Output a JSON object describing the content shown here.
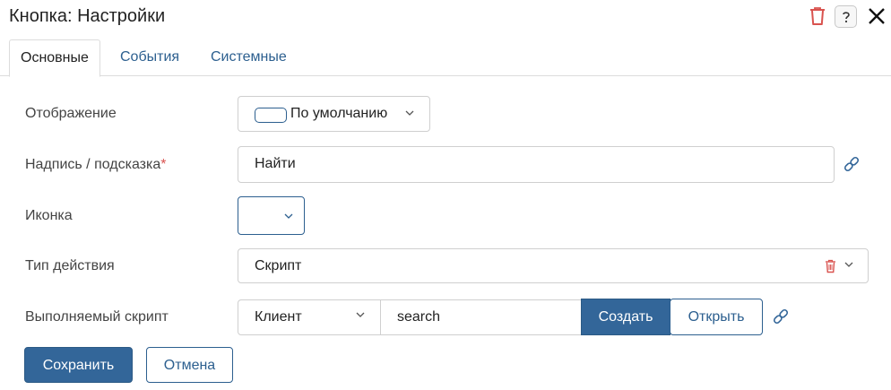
{
  "window": {
    "title": "Кнопка: Настройки"
  },
  "header_icons": {
    "delete": "trash-icon",
    "help": "help-icon",
    "close": "close-icon"
  },
  "tabs": [
    {
      "label": "Основные",
      "active": true
    },
    {
      "label": "События",
      "active": false
    },
    {
      "label": "Системные",
      "active": false
    }
  ],
  "form": {
    "display": {
      "label": "Отображение",
      "value": "По умолчанию"
    },
    "caption": {
      "label": "Надпись / подсказка",
      "required_mark": "*",
      "value": "Найти"
    },
    "icon": {
      "label": "Иконка",
      "value": ""
    },
    "action_type": {
      "label": "Тип действия",
      "value": "Скрипт"
    },
    "script": {
      "label": "Выполняемый скрипт",
      "side": "Клиент",
      "name": "search",
      "create_label": "Создать",
      "open_label": "Открыть"
    }
  },
  "footer": {
    "save_label": "Сохранить",
    "cancel_label": "Отмена"
  },
  "colors": {
    "accent": "#336699",
    "danger": "#d9534f",
    "border": "#cfcfcf"
  }
}
